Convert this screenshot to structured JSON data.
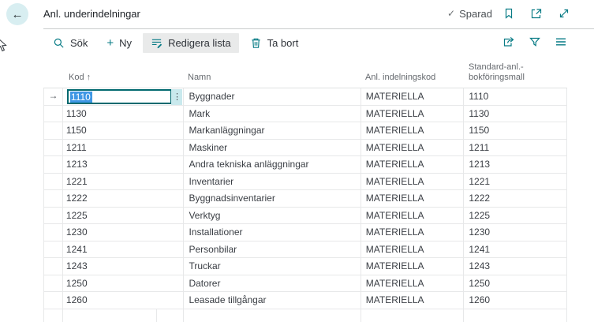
{
  "icons": {
    "back": "←",
    "check": "✓",
    "plus": "+",
    "row_arrow": "→",
    "ellipsis": "⋮",
    "sort_asc": "↑"
  },
  "header": {
    "title": "Anl. underindelningar",
    "saved_label": "Sparad"
  },
  "toolbar": {
    "search_label": "Sök",
    "new_label": "Ny",
    "edit_list_label": "Redigera lista",
    "delete_label": "Ta bort"
  },
  "table": {
    "columns": {
      "kod": "Kod",
      "namn": "Namn",
      "indelningskod": "Anl. indelningskod",
      "bokforingsmall": "Standard-anl.-bokföringsmall"
    },
    "sorted_by": "Kod",
    "selected": {
      "row_index": 0,
      "edit_value": "1110"
    },
    "rows": [
      {
        "kod": "1110",
        "namn": "Byggnader",
        "indelningskod": "MATERIELLA",
        "bokforingsmall": "1110"
      },
      {
        "kod": "1130",
        "namn": "Mark",
        "indelningskod": "MATERIELLA",
        "bokforingsmall": "1130"
      },
      {
        "kod": "1150",
        "namn": "Markanläggningar",
        "indelningskod": "MATERIELLA",
        "bokforingsmall": "1150"
      },
      {
        "kod": "1211",
        "namn": "Maskiner",
        "indelningskod": "MATERIELLA",
        "bokforingsmall": "1211"
      },
      {
        "kod": "1213",
        "namn": "Andra tekniska anläggningar",
        "indelningskod": "MATERIELLA",
        "bokforingsmall": "1213"
      },
      {
        "kod": "1221",
        "namn": "Inventarier",
        "indelningskod": "MATERIELLA",
        "bokforingsmall": "1221"
      },
      {
        "kod": "1222",
        "namn": "Byggnadsinventarier",
        "indelningskod": "MATERIELLA",
        "bokforingsmall": "1222"
      },
      {
        "kod": "1225",
        "namn": "Verktyg",
        "indelningskod": "MATERIELLA",
        "bokforingsmall": "1225"
      },
      {
        "kod": "1230",
        "namn": "Installationer",
        "indelningskod": "MATERIELLA",
        "bokforingsmall": "1230"
      },
      {
        "kod": "1241",
        "namn": "Personbilar",
        "indelningskod": "MATERIELLA",
        "bokforingsmall": "1241"
      },
      {
        "kod": "1243",
        "namn": "Truckar",
        "indelningskod": "MATERIELLA",
        "bokforingsmall": "1243"
      },
      {
        "kod": "1250",
        "namn": "Datorer",
        "indelningskod": "MATERIELLA",
        "bokforingsmall": "1250"
      },
      {
        "kod": "1260",
        "namn": "Leasade tillgångar",
        "indelningskod": "MATERIELLA",
        "bokforingsmall": "1260"
      }
    ]
  },
  "colors": {
    "accent_teal": "#077b85",
    "edit_border_teal": "#01696f",
    "selection_blue": "#3f97e4",
    "ellipsis_bg": "#c9e9ed",
    "back_circle_bg": "#d8eef1",
    "active_button_bg": "#e9eaea"
  }
}
